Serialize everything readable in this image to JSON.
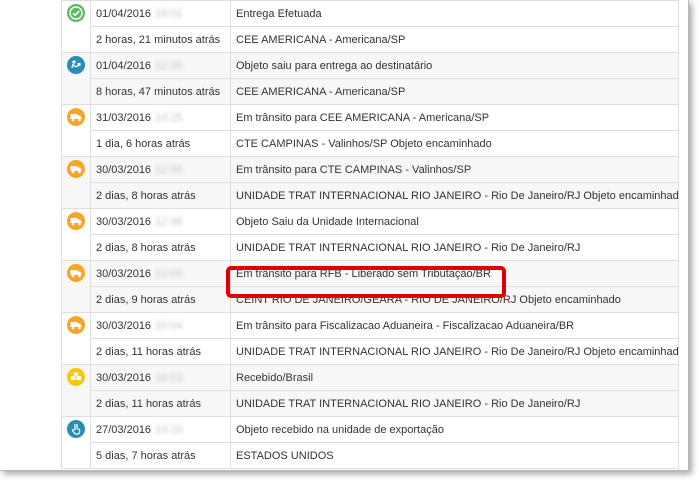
{
  "events": [
    {
      "icon": "check-icon",
      "icon_color": "#5cb85c",
      "date": "01/04/2016",
      "time_blurred": "19:01",
      "status": "Entrega Efetuada",
      "relative": "2 horas, 21 minutos atrás",
      "location": "CEE AMERICANA - Americana/SP"
    },
    {
      "icon": "delivery-courier-icon",
      "icon_color": "#2a8db5",
      "date": "01/04/2016",
      "time_blurred": "12:35",
      "status": "Objeto saiu para entrega ao destinatário",
      "relative": "8 horas, 47 minutos atrás",
      "location": "CEE AMERICANA - Americana/SP"
    },
    {
      "icon": "truck-icon",
      "icon_color": "#f5a623",
      "date": "31/03/2016",
      "time_blurred": "14:25",
      "status": "Em trânsito para CEE AMERICANA - Americana/SP",
      "relative": "1 dia, 6 horas atrás",
      "location": "CTE CAMPINAS - Valinhos/SP Objeto encaminhado"
    },
    {
      "icon": "truck-icon",
      "icon_color": "#f5a623",
      "date": "30/03/2016",
      "time_blurred": "12:50",
      "status": "Em trânsito para CTE CAMPINAS - Valinhos/SP",
      "relative": "2 dias, 8 horas atrás",
      "location": "UNIDADE TRAT INTERNACIONAL RIO JANEIRO - Rio De Janeiro/RJ Objeto encaminhado"
    },
    {
      "icon": "truck-icon",
      "icon_color": "#f5a623",
      "date": "30/03/2016",
      "time_blurred": "12:48",
      "status": "Objeto Saiu da Unidade Internacional",
      "relative": "2 dias, 8 horas atrás",
      "location": "UNIDADE TRAT INTERNACIONAL RIO JANEIRO - Rio De Janeiro/RJ"
    },
    {
      "icon": "truck-icon",
      "icon_color": "#f5a623",
      "date": "30/03/2016",
      "time_blurred": "12:05",
      "status": "Em trânsito para RFB - Liberado sem Tributação/BR",
      "relative": "2 dias, 9 horas atrás",
      "location": "CEINT RIO DE JANEIRO/GEARA - RIO DE JANEIRO/RJ Objeto encaminhado"
    },
    {
      "icon": "truck-icon",
      "icon_color": "#f5a623",
      "date": "30/03/2016",
      "time_blurred": "10:04",
      "status": "Em trânsito para Fiscalizacao Aduaneira - Fiscalizacao Aduaneira/BR",
      "relative": "2 dias, 11 horas atrás",
      "location": "UNIDADE TRAT INTERNACIONAL RIO JANEIRO - Rio De Janeiro/RJ Objeto encaminhado"
    },
    {
      "icon": "boxes-icon",
      "icon_color": "#f2c811",
      "date": "30/03/2016",
      "time_blurred": "10:03",
      "status": "Recebido/Brasil",
      "relative": "2 dias, 11 horas atrás",
      "location": "UNIDADE TRAT INTERNACIONAL RIO JANEIRO - Rio De Janeiro/RJ"
    },
    {
      "icon": "hand-pointer-icon",
      "icon_color": "#2a8db5",
      "date": "27/03/2016",
      "time_blurred": "13:20",
      "status": "Objeto recebido na unidade de exportação",
      "relative": "5 dias, 7 horas atrás",
      "location": "ESTADOS UNIDOS"
    }
  ],
  "highlight_color": "#e00000"
}
